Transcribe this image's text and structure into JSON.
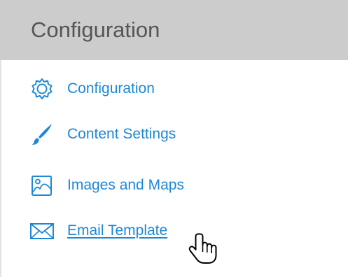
{
  "panel": {
    "title": "Configuration"
  },
  "menu": {
    "items": [
      {
        "label": "Configuration",
        "icon": "gear-icon"
      },
      {
        "label": "Content Settings",
        "icon": "brush-icon"
      },
      {
        "label": "Images and Maps",
        "icon": "image-icon"
      },
      {
        "label": "Email Template",
        "icon": "envelope-icon",
        "state": "hovered"
      }
    ]
  },
  "colors": {
    "header_bg": "#cccccc",
    "title_text": "#555555",
    "link": "#1e88d6"
  },
  "cursor": {
    "icon": "hand-pointer-icon"
  }
}
